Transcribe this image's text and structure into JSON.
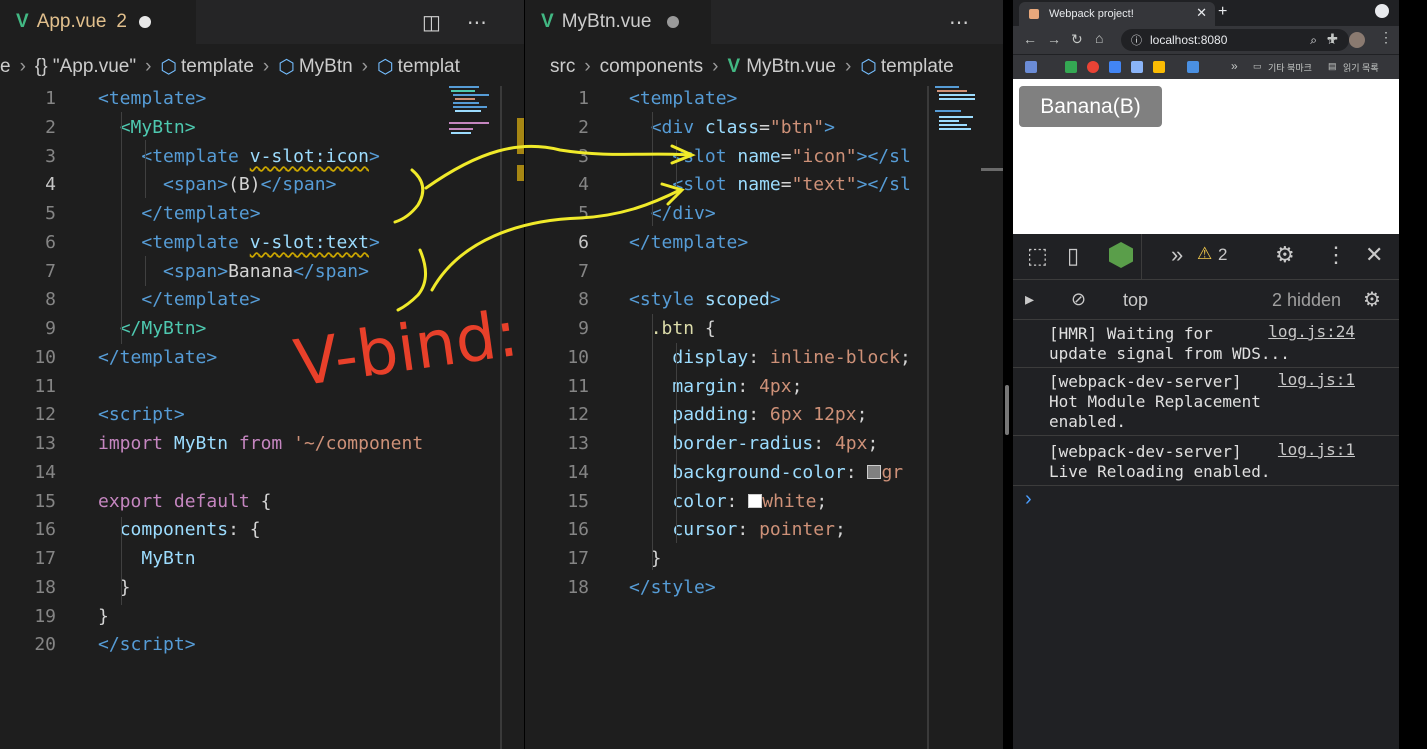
{
  "left_editor": {
    "tab": {
      "icon": "vue-icon",
      "name": "App.vue",
      "problems": "2"
    },
    "breadcrumb": [
      "e",
      "{} \"App.vue\"",
      "template",
      "MyBtn",
      "templat"
    ],
    "lines": [
      {
        "n": "1",
        "html": "<span class='t'>&lt;template&gt;</span>"
      },
      {
        "n": "2",
        "html": "  <span class='c'>&lt;MyBtn&gt;</span>"
      },
      {
        "n": "3",
        "html": "    <span class='t'>&lt;template</span> <span class='a wav'>v-slot:icon</span><span class='t'>&gt;</span>"
      },
      {
        "n": "4",
        "html": "      <span class='t'>&lt;span&gt;</span>(B)<span class='t'>&lt;/span&gt;</span>"
      },
      {
        "n": "5",
        "html": "    <span class='t'>&lt;/template&gt;</span>"
      },
      {
        "n": "6",
        "html": "    <span class='t'>&lt;template</span> <span class='a wav'>v-slot:text</span><span class='t'>&gt;</span>"
      },
      {
        "n": "7",
        "html": "      <span class='t'>&lt;span&gt;</span>Banana<span class='t'>&lt;/span&gt;</span>"
      },
      {
        "n": "8",
        "html": "    <span class='t'>&lt;/template&gt;</span>"
      },
      {
        "n": "9",
        "html": "  <span class='c'>&lt;/MyBtn&gt;</span>"
      },
      {
        "n": "10",
        "html": "<span class='t'>&lt;/template&gt;</span>"
      },
      {
        "n": "11",
        "html": ""
      },
      {
        "n": "12",
        "html": "<span class='t'>&lt;script&gt;</span>"
      },
      {
        "n": "13",
        "html": "<span class='k'>import</span> <span class='a'>MyBtn</span> <span class='k'>from</span> <span class='s'>'~/component</span>"
      },
      {
        "n": "14",
        "html": ""
      },
      {
        "n": "15",
        "html": "<span class='k'>export</span> <span class='k'>default</span> {"
      },
      {
        "n": "16",
        "html": "  <span class='a'>components</span>: {"
      },
      {
        "n": "17",
        "html": "    <span class='a'>MyBtn</span>"
      },
      {
        "n": "18",
        "html": "  }"
      },
      {
        "n": "19",
        "html": "}"
      },
      {
        "n": "20",
        "html": "<span class='t'>&lt;/script&gt;</span>"
      }
    ],
    "current_line": "4"
  },
  "mid_editor": {
    "tab": {
      "icon": "vue-icon",
      "name": "MyBtn.vue"
    },
    "breadcrumb": [
      "src",
      "components",
      "MyBtn.vue",
      "template"
    ],
    "lines": [
      {
        "n": "1",
        "html": "<span class='t'>&lt;template&gt;</span>"
      },
      {
        "n": "2",
        "html": "  <span class='t'>&lt;div</span> <span class='a'>class</span>=<span class='s'>\"btn\"</span><span class='t'>&gt;</span>"
      },
      {
        "n": "3",
        "html": "    <span class='t'>&lt;slot</span> <span class='a'>name</span>=<span class='s'>\"icon\"</span><span class='t'>&gt;&lt;/sl</span>"
      },
      {
        "n": "4",
        "html": "    <span class='t'>&lt;slot</span> <span class='a'>name</span>=<span class='s'>\"text\"</span><span class='t'>&gt;&lt;/sl</span>"
      },
      {
        "n": "5",
        "html": "  <span class='t'>&lt;/div&gt;</span>"
      },
      {
        "n": "6",
        "html": "<span class='t'>&lt;/template&gt;</span>"
      },
      {
        "n": "7",
        "html": ""
      },
      {
        "n": "8",
        "html": "<span class='t'>&lt;style</span> <span class='a'>scoped</span><span class='t'>&gt;</span>"
      },
      {
        "n": "9",
        "html": "  <span class='y'>.btn</span> {"
      },
      {
        "n": "10",
        "html": "    <span class='a'>display</span>: <span class='s'>inline-block</span>;"
      },
      {
        "n": "11",
        "html": "    <span class='a'>margin</span>: <span class='s'>4px</span>;"
      },
      {
        "n": "12",
        "html": "    <span class='a'>padding</span>: <span class='s'>6px 12px</span>;"
      },
      {
        "n": "13",
        "html": "    <span class='a'>border-radius</span>: <span class='s'>4px</span>;"
      },
      {
        "n": "14",
        "html": "    <span class='a'>background-color</span>: <span style='display:inline-block;width:14px;height:14px;background:#808080;border:1px solid #ccc;vertical-align:-1px'></span><span class='s'>gr</span>"
      },
      {
        "n": "15",
        "html": "    <span class='a'>color</span>: <span style='display:inline-block;width:14px;height:14px;background:#ffffff;border:1px solid #ccc;vertical-align:-1px'></span><span class='s'>white</span>;"
      },
      {
        "n": "16",
        "html": "    <span class='a'>cursor</span>: <span class='s'>pointer</span>;"
      },
      {
        "n": "17",
        "html": "  }"
      },
      {
        "n": "18",
        "html": "<span class='t'>&lt;/style&gt;</span>"
      }
    ],
    "current_line": "6"
  },
  "browser": {
    "tab_title": "Webpack project!",
    "url": "localhost:8080",
    "bookmarks": [
      "기타 북마크",
      "읽기 목록"
    ],
    "page_button": "Banana(B)"
  },
  "devtools": {
    "warnings": "2",
    "context": "top",
    "hidden": "2 hidden",
    "messages": [
      {
        "text": "[HMR] Waiting for\nupdate signal from WDS...",
        "source": "log.js:24"
      },
      {
        "text": "[webpack-dev-server]\nHot Module Replacement\nenabled.",
        "source": "log.js:1"
      },
      {
        "text": "[webpack-dev-server]\nLive Reloading enabled.",
        "source": "log.js:1"
      }
    ],
    "prompt": "›"
  },
  "annotation": {
    "text": "V-bind:"
  },
  "colors": {
    "accent_vue": "#42b883",
    "tab_problem": "#e2c08d",
    "annotation_red": "#e8402a",
    "annotation_yellow": "#f0ea2a"
  }
}
